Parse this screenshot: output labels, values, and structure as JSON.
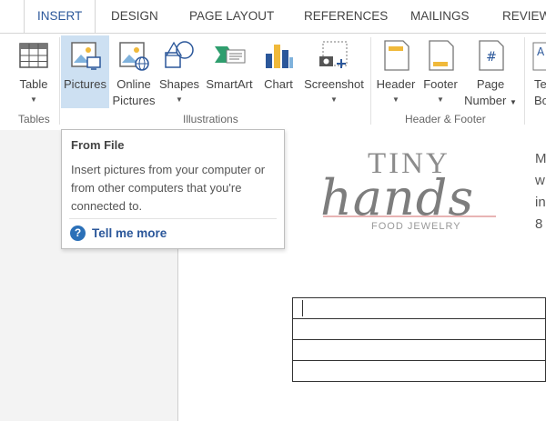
{
  "tabs": [
    {
      "label": "INSERT",
      "active": true
    },
    {
      "label": "DESIGN",
      "active": false
    },
    {
      "label": "PAGE LAYOUT",
      "active": false
    },
    {
      "label": "REFERENCES",
      "active": false
    },
    {
      "label": "MAILINGS",
      "active": false
    },
    {
      "label": "REVIEW",
      "active": false
    }
  ],
  "ribbon": {
    "table": {
      "label": "Table"
    },
    "pictures": {
      "label": "Pictures",
      "selected": true
    },
    "online_pictures": {
      "line1": "Online",
      "line2": "Pictures"
    },
    "shapes": {
      "label": "Shapes"
    },
    "smartart": {
      "label": "SmartArt"
    },
    "chart": {
      "label": "Chart"
    },
    "screenshot": {
      "label": "Screenshot"
    },
    "header": {
      "label": "Header"
    },
    "footer": {
      "label": "Footer"
    },
    "page_number": {
      "line1": "Page",
      "line2": "Number"
    },
    "textbox": {
      "line1": "Te",
      "line2": "Bo"
    },
    "groups": {
      "tables": "Tables",
      "illustrations": "Illustrations",
      "header_footer": "Header & Footer"
    }
  },
  "tooltip": {
    "title": "From File",
    "body": "Insert pictures from your computer or from other computers that you're connected to.",
    "link": "Tell me more"
  },
  "document": {
    "logo_top": "TINY",
    "logo_main": "hands",
    "logo_sub": "FOOD JEWELRY",
    "side_text": [
      "M",
      "w",
      "in",
      "8"
    ]
  },
  "colors": {
    "accent": "#2b579a",
    "selected": "#cde0f2",
    "help": "#2b70b8",
    "logo_line": "#e8b4b4"
  }
}
